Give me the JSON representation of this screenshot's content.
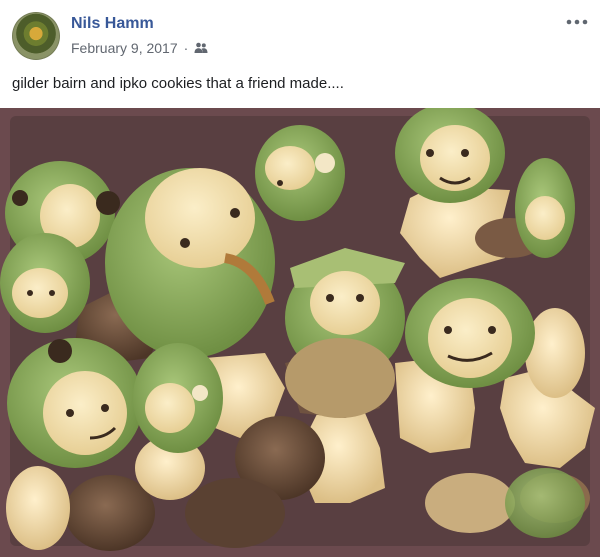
{
  "post": {
    "author": "Nils Hamm",
    "date": "February 9, 2017",
    "separator": "·",
    "caption": "gilder bairn and ipko cookies that a friend made....",
    "audience_icon": "friends-icon",
    "more_icon": "more-options-icon",
    "image_subject": "cookies"
  },
  "colors": {
    "author_link": "#385898",
    "meta_text": "#616770"
  }
}
